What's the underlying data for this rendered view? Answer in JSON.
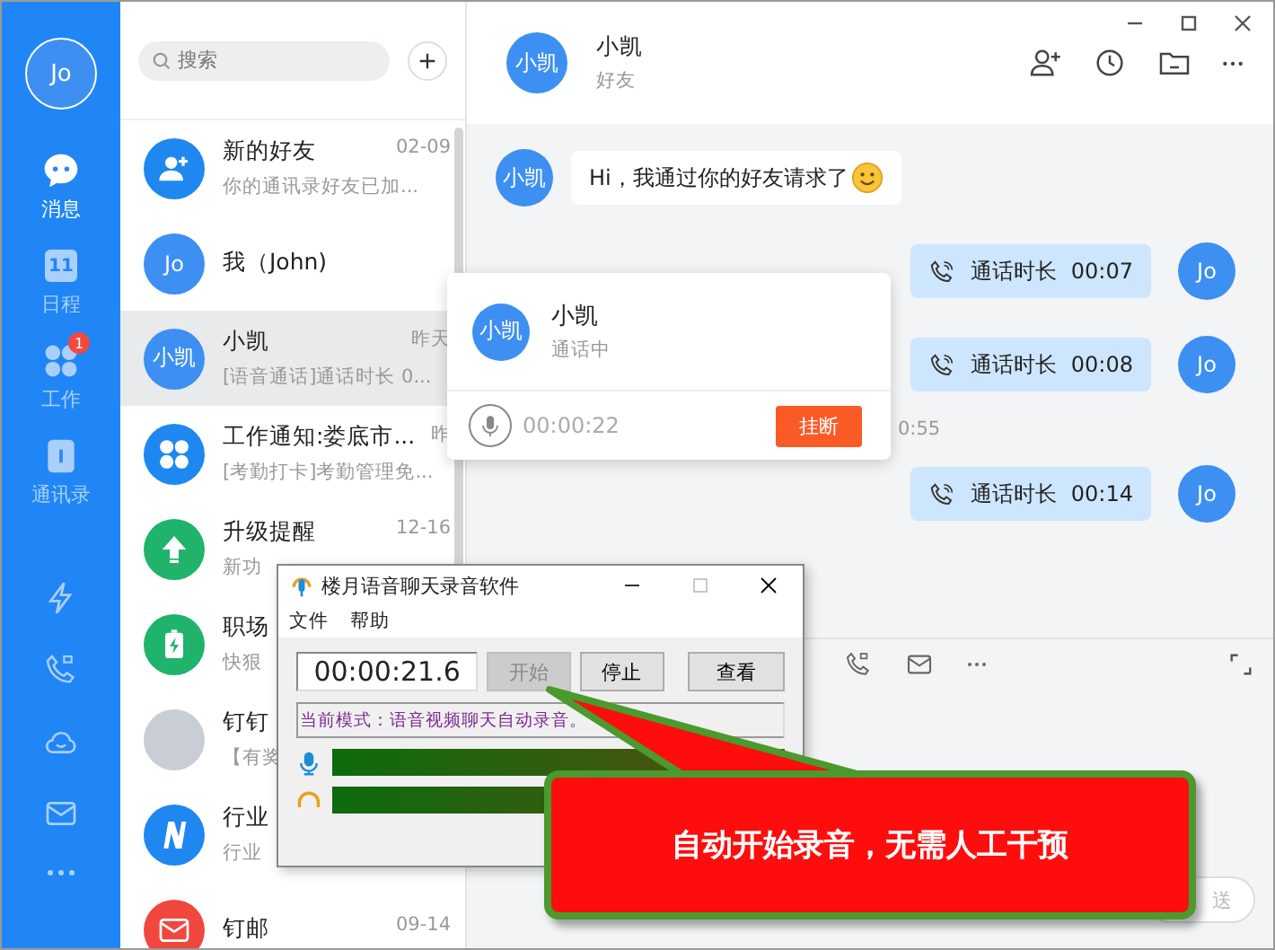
{
  "rail": {
    "avatar": "Jo",
    "nav": [
      {
        "kind": "chat",
        "label": "消息",
        "selected": true
      },
      {
        "kind": "calendar",
        "label": "日程",
        "selected": false,
        "day": "11"
      },
      {
        "kind": "clover",
        "label": "工作",
        "selected": false,
        "badge": "1"
      },
      {
        "kind": "contacts",
        "label": "通讯录",
        "selected": false
      }
    ]
  },
  "chat_list": {
    "search": {
      "placeholder": "搜索"
    },
    "items": [
      {
        "avatar": {
          "kind": "add-user",
          "color": "#1e88f0"
        },
        "name": "新的好友",
        "time": "02-09",
        "preview": "你的通讯录好友已加...",
        "selected": false
      },
      {
        "avatar": {
          "kind": "text",
          "text": "Jo",
          "color": "#3d8ff2"
        },
        "name": "我（John)",
        "selected": false
      },
      {
        "avatar": {
          "kind": "text",
          "text": "小凯",
          "color": "#3d8ff2"
        },
        "name": "小凯",
        "time": "昨天",
        "preview": "[语音通话]通话时长 0...",
        "selected": true
      },
      {
        "avatar": {
          "kind": "clover",
          "color": "#1e88f0"
        },
        "name": "工作通知:娄底市...",
        "time": "昨",
        "preview": "[考勤打卡]考勤管理免...",
        "selected": false
      },
      {
        "avatar": {
          "kind": "upload",
          "color": "#1fb36b"
        },
        "name": "升级提醒",
        "time": "12-16",
        "preview": "新功",
        "selected": false
      },
      {
        "avatar": {
          "kind": "battery",
          "color": "#1fb36b"
        },
        "name": "职场",
        "preview": "快狠",
        "selected": false
      },
      {
        "avatar": {
          "kind": "photo",
          "color": "#c9ced6"
        },
        "name": "钉钉",
        "preview": "【有奖",
        "selected": false
      },
      {
        "avatar": {
          "kind": "letter-n",
          "color": "#1e88f0"
        },
        "name": "行业",
        "preview": "行业",
        "selected": false
      },
      {
        "avatar": {
          "kind": "mail",
          "color": "#f0483e"
        },
        "name": "钉邮",
        "time": "09-14",
        "selected": false
      }
    ]
  },
  "conversation": {
    "avatar": "小凯",
    "name": "小凯",
    "subtitle": "好友",
    "messages": [
      {
        "kind": "incoming",
        "avatar": "小凯",
        "text": "Hi，我通过你的好友请求了"
      },
      {
        "kind": "call",
        "avatar": "Jo",
        "label": "通话时长",
        "duration": "00:07"
      },
      {
        "kind": "call",
        "avatar": "Jo",
        "label": "通话时长",
        "duration": "00:08"
      },
      {
        "kind": "time",
        "text": "0:55"
      },
      {
        "kind": "call",
        "avatar": "Jo",
        "label": "通话时长",
        "duration": "00:14"
      }
    ],
    "send": "送"
  },
  "call_popup": {
    "avatar": "小凯",
    "name": "小凯",
    "status": "通话中",
    "timer": "00:00:22",
    "hangup": "挂断"
  },
  "recorder": {
    "title": "楼月语音聊天录音软件",
    "menu": [
      "文件",
      "帮助"
    ],
    "time": "00:00:21.6",
    "buttons": [
      {
        "label": "开始",
        "disabled": true
      },
      {
        "label": "停止",
        "disabled": false
      },
      {
        "label": "查看",
        "disabled": false
      }
    ],
    "mode": "当前模式：语音视频聊天自动录音。"
  },
  "callout": {
    "text": "自动开始录音，无需人工干预"
  }
}
